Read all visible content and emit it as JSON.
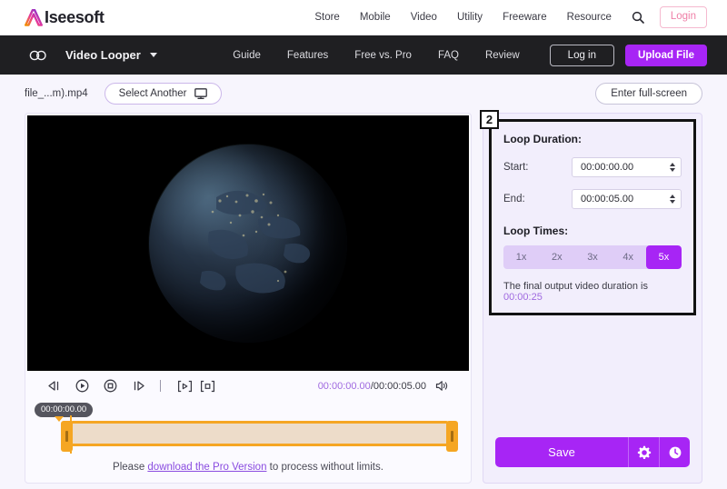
{
  "topbar": {
    "logo_text_a": "I",
    "logo_text_b": "seesoft",
    "nav": [
      {
        "label": "Store"
      },
      {
        "label": "Mobile"
      },
      {
        "label": "Video"
      },
      {
        "label": "Utility"
      },
      {
        "label": "Freeware"
      },
      {
        "label": "Resource"
      }
    ],
    "search_icon": "search-icon",
    "login_label": "Login",
    "login_border_color": "#f5b9cf",
    "login_text_color": "#ef7fa7"
  },
  "darknav": {
    "loop_icon": "infinity-loop-icon",
    "product": "Video Looper",
    "links": [
      {
        "label": "Guide"
      },
      {
        "label": "Features"
      },
      {
        "label": "Free vs. Pro"
      },
      {
        "label": "FAQ"
      },
      {
        "label": "Review"
      }
    ],
    "login_label": "Log in",
    "upload_label": "Upload File",
    "background": "#1f1f22",
    "accent": "#a725f5"
  },
  "filebar": {
    "filename": "file_...m).mp4",
    "select_another": "Select Another",
    "monitor_icon": "monitor-icon",
    "fullscreen": "Enter full-screen"
  },
  "player": {
    "scene": "earth-from-space-night",
    "controls": [
      {
        "name": "rewind-button",
        "icon": "rewind-icon"
      },
      {
        "name": "play-button",
        "icon": "play-circle-icon"
      },
      {
        "name": "stop-button",
        "icon": "stop-circle-icon"
      },
      {
        "name": "forward-button",
        "icon": "fast-forward-icon"
      }
    ],
    "bracket_controls": [
      {
        "name": "mark-play-button",
        "icon": "bracket-play-icon"
      },
      {
        "name": "mark-stop-button",
        "icon": "bracket-stop-icon"
      }
    ],
    "current_time": "00:00:00.00",
    "time_separator": "/",
    "total_time": "00:00:05.00",
    "volume_icon": "speaker-icon",
    "playhead_tooltip": "00:00:00.00",
    "trim_color": "#f5a623",
    "promo_prefix": "Please ",
    "promo_link": "download the Pro Version",
    "promo_suffix": " to process without limits."
  },
  "settings": {
    "badge": "2",
    "loop_duration_title": "Loop Duration:",
    "start_label": "Start:",
    "start_value": "00:00:00.00",
    "end_label": "End:",
    "end_value": "00:00:05.00",
    "loop_times_title": "Loop Times:",
    "loop_options": [
      "1x",
      "2x",
      "3x",
      "4x",
      "5x"
    ],
    "loop_selected": "5x",
    "final_note_prefix": "The final output video duration is ",
    "final_note_value": "00:00:25",
    "save_label": "Save",
    "gear_icon": "gear-icon",
    "clock_icon": "clock-icon",
    "accent": "#a725f5",
    "highlight_border": "#121212"
  }
}
